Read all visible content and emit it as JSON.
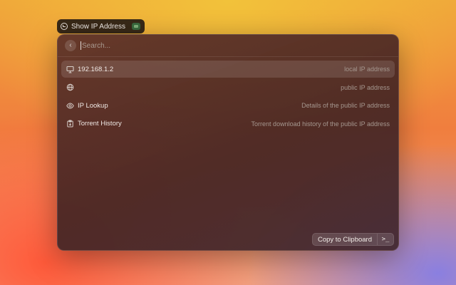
{
  "command": {
    "title": "Show IP Address",
    "app_icon": "clock-check-icon",
    "extension_badge": "extension-badge-icon"
  },
  "search": {
    "placeholder": "Search...",
    "value": ""
  },
  "items": [
    {
      "icon": "monitor-icon",
      "title": "192.168.1.2",
      "subtitle": "local IP address",
      "selected": true
    },
    {
      "icon": "globe-icon",
      "title": "",
      "subtitle": "public IP address",
      "selected": false
    },
    {
      "icon": "eye-icon",
      "title": "IP Lookup",
      "subtitle": "Details of the public IP address",
      "selected": false
    },
    {
      "icon": "clipboard-icon",
      "title": "Torrent History",
      "subtitle": "Torrent download history of the public IP address",
      "selected": false
    }
  ],
  "footer": {
    "primary_action": "Copy to Clipboard",
    "actions_label": ">_"
  }
}
